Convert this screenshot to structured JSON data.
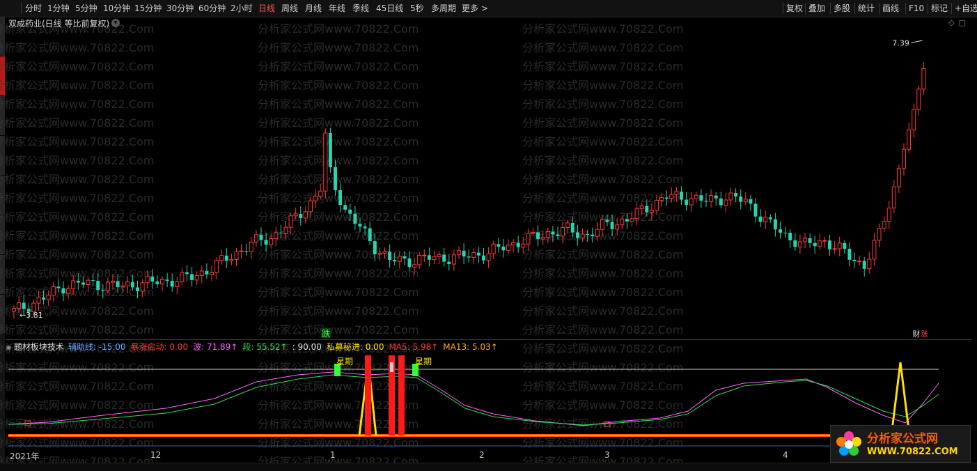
{
  "toolbar": {
    "periods": [
      "分时",
      "1分钟",
      "5分钟",
      "10分钟",
      "15分钟",
      "30分钟",
      "60分钟",
      "2小时",
      "日线",
      "周线",
      "月线",
      "年线",
      "季线",
      "45日线",
      "5秒",
      "多周期",
      "更多 >"
    ],
    "active_period": "日线",
    "right_items": [
      "复权",
      "叠加",
      "多股",
      "统计",
      "画线",
      "F10",
      "标记",
      "+自选"
    ]
  },
  "stock": {
    "title": "双成药业(日线 等比前复权)",
    "high_label": "7.39",
    "low_label": "3.81",
    "fall_marker": "跌",
    "finance_badge": "财",
    "rise_badge": "涨"
  },
  "watermark": {
    "text": "分析家公式网www.70822.Com"
  },
  "indicator": {
    "name": "题材板块技术",
    "params": [
      {
        "label": "辅助线",
        "value": ": -15.00",
        "color": "#66a3ff"
      },
      {
        "label": "暴涨启动",
        "value": ": 0.00",
        "color": "#ff3a3a"
      },
      {
        "label": "波",
        "value": ": 71.89↑",
        "color": "#ff66ff"
      },
      {
        "label": "段",
        "value": ": 55.52↑",
        "color": "#33dd55"
      },
      {
        "label": "",
        "value": ": 90.00",
        "color": "#dddddd"
      },
      {
        "label": "私募秘进",
        "value": ": 0.00",
        "color": "#ffe000"
      },
      {
        "label": "MA5",
        "value": ": 5.98↑",
        "color": "#ff3a3a"
      },
      {
        "label": "MA13",
        "value": ": 5.03↑",
        "color": "#ffb000"
      }
    ],
    "star_label": "星期"
  },
  "time_axis": [
    "2021年",
    "12",
    "1",
    "2",
    "3",
    "4"
  ],
  "logo": {
    "title": "分析家公式网",
    "url": "WWW.70822.COM"
  },
  "colors": {
    "up": "#ff3a3a",
    "down": "#26d5b0",
    "background": "#000000"
  }
}
